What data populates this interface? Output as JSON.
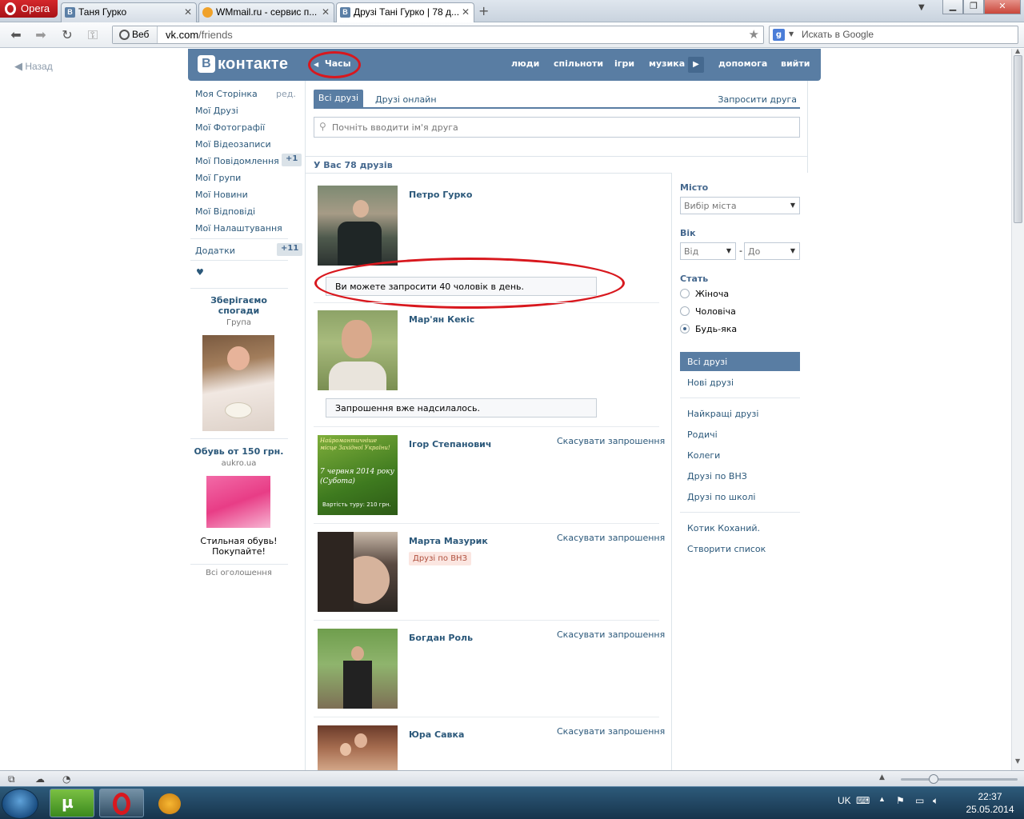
{
  "browser": {
    "app": "Opera",
    "tabs": [
      {
        "icon": "vk-icon",
        "title": "Таня Гурко"
      },
      {
        "icon": "wmmail-icon",
        "title": "WMmail.ru - сервис п..."
      },
      {
        "icon": "vk-icon",
        "title": "Друзі Тані Гурко | 78 д..."
      }
    ],
    "address": {
      "mode": "Веб",
      "url_domain": "vk.com",
      "url_path": "/friends"
    },
    "search_placeholder": "Искать в Google"
  },
  "header": {
    "logo_text": "контакте",
    "logo_letter": "В",
    "back_label": "Назад",
    "player_label": "Часы",
    "nav": [
      "люди",
      "спільноти",
      "ігри",
      "музика",
      "допомога",
      "вийти"
    ]
  },
  "left_menu": {
    "items": [
      {
        "label": "Моя Сторінка",
        "extra": "ред."
      },
      {
        "label": "Мої Друзі"
      },
      {
        "label": "Мої Фотографії"
      },
      {
        "label": "Мої Відеозаписи"
      },
      {
        "label": "Мої Повідомлення",
        "badge": "+1"
      },
      {
        "label": "Мої Групи"
      },
      {
        "label": "Мої Новини"
      },
      {
        "label": "Мої Відповіді"
      },
      {
        "label": "Мої Налаштування"
      }
    ],
    "apps": {
      "label": "Додатки",
      "badge": "+11"
    },
    "heart": "♥",
    "ads": [
      {
        "title": "Зберігаємо спогади",
        "subtitle": "Група"
      },
      {
        "title": "Обувь от 150 грн.",
        "subtitle": "aukro.ua",
        "text": "Стильная обувь! Покупайте!"
      }
    ],
    "all_ads": "Всі оголошення"
  },
  "friends": {
    "tabs": {
      "all": "Всі друзі",
      "online": "Друзі онлайн",
      "invite": "Запросити друга"
    },
    "search_placeholder": "Почніть вводити ім'я друга",
    "count_text": "У Вас 78 друзів",
    "list": [
      {
        "name": "Петро Гурко",
        "note": "Ви можете запросити 40 чоловік в день."
      },
      {
        "name": "Мар'ян Кекіс",
        "note": "Запрошення вже надсилалось."
      },
      {
        "name": "Ігор Степанович",
        "action": "Скасувати запрошення",
        "photo_text": [
          "Найромантичніше місце Західної України!",
          "7 червня 2014 року (Субота)",
          "Вартість туру: 210 грн."
        ]
      },
      {
        "name": "Марта Мазурик",
        "action": "Скасувати запрошення",
        "tag": "Друзі по ВНЗ"
      },
      {
        "name": "Богдан Роль",
        "action": "Скасувати запрошення"
      },
      {
        "name": "Юра Савка",
        "action": "Скасувати запрошення"
      }
    ]
  },
  "filters": {
    "city_label": "Місто",
    "city_value": "Вибір міста",
    "age_label": "Вік",
    "age_from": "Від",
    "age_dash": "-",
    "age_to": "До",
    "sex_label": "Стать",
    "sex_options": [
      "Жіноча",
      "Чоловіча",
      "Будь-яка"
    ],
    "sex_selected": "Будь-яка",
    "lists": [
      "Всі друзі",
      "Нові друзі",
      "Найкращі друзі",
      "Родичі",
      "Колеги",
      "Друзі по ВНЗ",
      "Друзі по школі",
      "Котик Коханий.",
      "Створити список"
    ]
  },
  "taskbar": {
    "lang": "UK",
    "time": "22:37",
    "date": "25.05.2014"
  },
  "colors": {
    "vk_blue": "#597da3",
    "link": "#2b587a",
    "annotation_red": "#d8181e",
    "opera_red": "#c21a1f"
  }
}
